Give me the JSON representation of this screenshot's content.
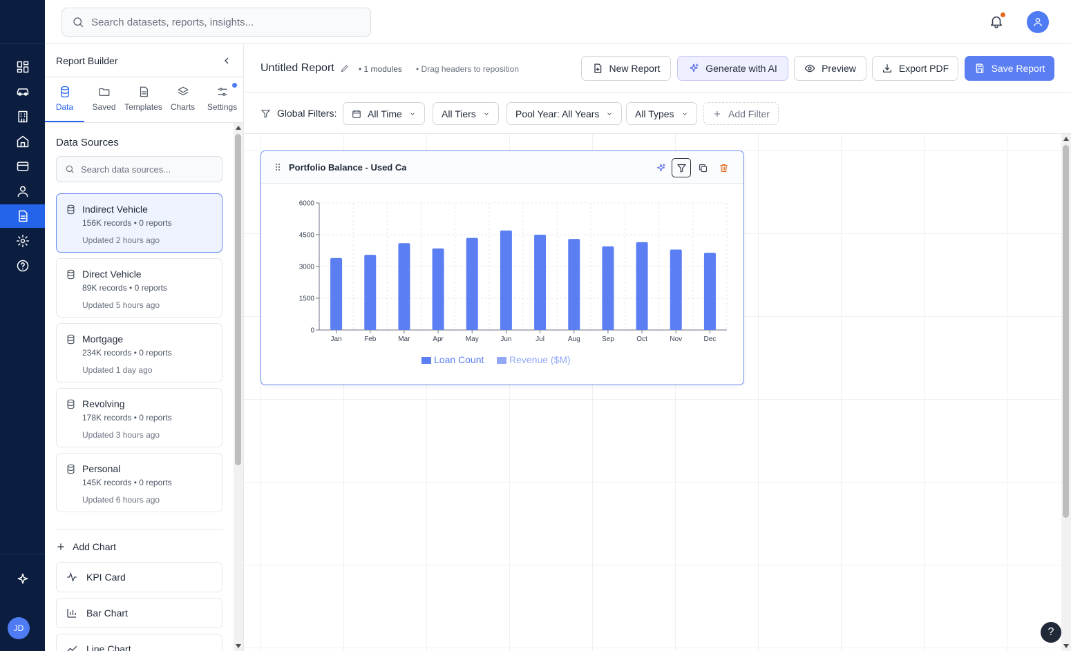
{
  "topbar": {
    "search_placeholder": "Search datasets, reports, insights..."
  },
  "rail": {
    "user_initials": "JD"
  },
  "panel": {
    "title": "Report Builder",
    "tabs": [
      {
        "label": "Data"
      },
      {
        "label": "Saved"
      },
      {
        "label": "Templates"
      },
      {
        "label": "Charts"
      },
      {
        "label": "Settings"
      }
    ],
    "data_sources_title": "Data Sources",
    "ds_search_placeholder": "Search data sources...",
    "sources": [
      {
        "name": "Indirect Vehicle",
        "meta": "156K records • 0 reports",
        "updated": "Updated 2 hours ago"
      },
      {
        "name": "Direct Vehicle",
        "meta": "89K records • 0 reports",
        "updated": "Updated 5 hours ago"
      },
      {
        "name": "Mortgage",
        "meta": "234K records • 0 reports",
        "updated": "Updated 1 day ago"
      },
      {
        "name": "Revolving",
        "meta": "178K records • 0 reports",
        "updated": "Updated 3 hours ago"
      },
      {
        "name": "Personal",
        "meta": "145K records • 0 reports",
        "updated": "Updated 6 hours ago"
      }
    ],
    "add_chart_label": "Add Chart",
    "chart_options": [
      {
        "label": "KPI Card"
      },
      {
        "label": "Bar Chart"
      },
      {
        "label": "Line Chart"
      }
    ]
  },
  "header": {
    "report_title": "Untitled Report",
    "modules": "• 1 modules",
    "drag_hint": "• Drag headers to reposition",
    "buttons": {
      "new_report": "New Report",
      "generate_ai": "Generate with AI",
      "preview": "Preview",
      "export_pdf": "Export PDF",
      "save_report": "Save Report"
    }
  },
  "filters": {
    "label": "Global Filters:",
    "time": "All Time",
    "tiers": "All Tiers",
    "pool_year": "Pool Year: All Years",
    "types": "All Types",
    "add": "Add Filter"
  },
  "module": {
    "title": "Portfolio Balance - Used Ca"
  },
  "help": "?",
  "colors": {
    "accent": "#5b7ff2",
    "rail": "#0b1e3f",
    "bar": "#5b7ff2",
    "legend_secondary": "#93a8f6",
    "notification": "#e36a1c"
  },
  "chart_data": {
    "type": "bar",
    "categories": [
      "Jan",
      "Feb",
      "Mar",
      "Apr",
      "May",
      "Jun",
      "Jul",
      "Aug",
      "Sep",
      "Oct",
      "Nov",
      "Dec"
    ],
    "series": [
      {
        "name": "Loan Count",
        "values": [
          3400,
          3550,
          4100,
          3850,
          4350,
          4700,
          4500,
          4300,
          3950,
          4150,
          3800,
          3650
        ]
      },
      {
        "name": "Revenue ($M)",
        "values": []
      }
    ],
    "y_ticks": [
      "0",
      "1500",
      "3000",
      "4500",
      "6000"
    ],
    "ylim": [
      0,
      6000
    ],
    "grid": true,
    "legend": "bottom"
  }
}
